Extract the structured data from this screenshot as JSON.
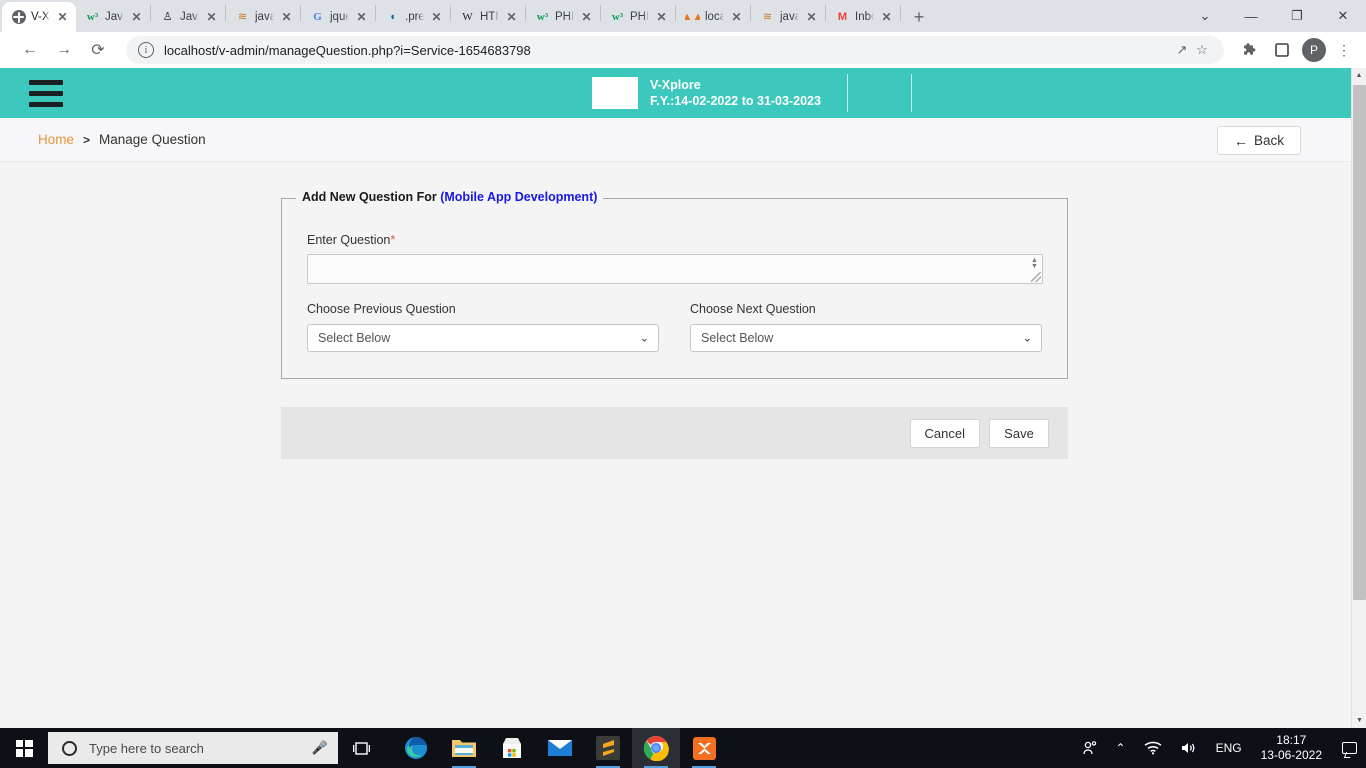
{
  "browser": {
    "tabs": [
      {
        "title": "V-Xp",
        "favicon": "globe-icon",
        "active": true
      },
      {
        "title": "JavaS",
        "favicon": "w3schools-icon",
        "active": false
      },
      {
        "title": "JavaS",
        "favicon": "java-icon",
        "active": false
      },
      {
        "title": "javas",
        "favicon": "javascript-doc-icon",
        "active": false
      },
      {
        "title": "jquer",
        "favicon": "google-icon",
        "active": false
      },
      {
        "title": ".prep",
        "favicon": "jquery-icon",
        "active": false
      },
      {
        "title": "HTM",
        "favicon": "wikipedia-icon",
        "active": false
      },
      {
        "title": "PHP",
        "favicon": "w3schools-icon",
        "active": false
      },
      {
        "title": "PHP",
        "favicon": "w3schools-icon",
        "active": false
      },
      {
        "title": "local",
        "favicon": "phpmyadmin-icon",
        "active": false
      },
      {
        "title": "javas",
        "favicon": "javascript-doc-icon",
        "active": false
      },
      {
        "title": "Inbo",
        "favicon": "gmail-icon",
        "active": false
      }
    ],
    "new_tab_label": "+",
    "close_label": "✕",
    "window_controls": {
      "minimize": "—",
      "maximize": "❐",
      "close": "✕",
      "tab_search": "⌄"
    },
    "toolbar": {
      "back": "←",
      "forward": "→",
      "reload": "⟳",
      "site_info_icon": "info-icon",
      "url": "localhost/v-admin/manageQuestion.php?i=Service-1654683798",
      "share_icon": "↗",
      "bookmark_icon": "☆",
      "extensions_icon": "puzzle-icon",
      "sidepanel_icon": "▢",
      "profile_initial": "P",
      "menu_icon": "⋮"
    }
  },
  "app": {
    "header": {
      "menu_icon": "hamburger-icon",
      "brand_name": "V-Xplore",
      "financial_year": "F.Y.:14-02-2022 to 31-03-2023",
      "user_avatar_icon": "user-avatar-icon"
    },
    "breadcrumb": {
      "home": "Home",
      "separator": ">",
      "current": "Manage Question"
    },
    "back_button": {
      "label": "Back",
      "icon": "arrow-left-icon"
    },
    "form": {
      "legend_prefix": "Add New Question For",
      "legend_subject": "(Mobile App Development)",
      "question_label": "Enter Question",
      "required_marker": "*",
      "question_value": "",
      "previous_question": {
        "label": "Choose Previous Question",
        "selected": "Select Below",
        "chevron": "⌄"
      },
      "next_question": {
        "label": "Choose Next Question",
        "selected": "Select Below",
        "chevron": "⌄"
      }
    },
    "footer": {
      "cancel_label": "Cancel",
      "save_label": "Save"
    },
    "colors": {
      "header_teal": "#3cc8bc",
      "breadcrumb_home": "#e8953c",
      "legend_subject": "#1919e6",
      "required": "#e8564a"
    }
  },
  "taskbar": {
    "start_icon": "windows-logo-icon",
    "search_placeholder": "Type here to search",
    "search_icon": "search-circle-icon",
    "mic_icon": "microphone-icon",
    "task_view_icon": "task-view-icon",
    "apps": [
      {
        "name": "edge-icon",
        "active": false,
        "running": false
      },
      {
        "name": "file-explorer-icon",
        "active": false,
        "running": true
      },
      {
        "name": "microsoft-store-icon",
        "active": false,
        "running": false
      },
      {
        "name": "mail-icon",
        "active": false,
        "running": false
      },
      {
        "name": "sublime-text-icon",
        "active": false,
        "running": true
      },
      {
        "name": "chrome-icon",
        "active": true,
        "running": true
      },
      {
        "name": "xampp-icon",
        "active": false,
        "running": true
      }
    ],
    "tray": {
      "people_icon": "people-icon",
      "overflow_icon": "⌃",
      "network_icon": "wifi-icon",
      "volume_icon": "speaker-icon",
      "language": "ENG",
      "time": "18:17",
      "date": "13-06-2022",
      "notification_icon": "notification-icon"
    }
  }
}
